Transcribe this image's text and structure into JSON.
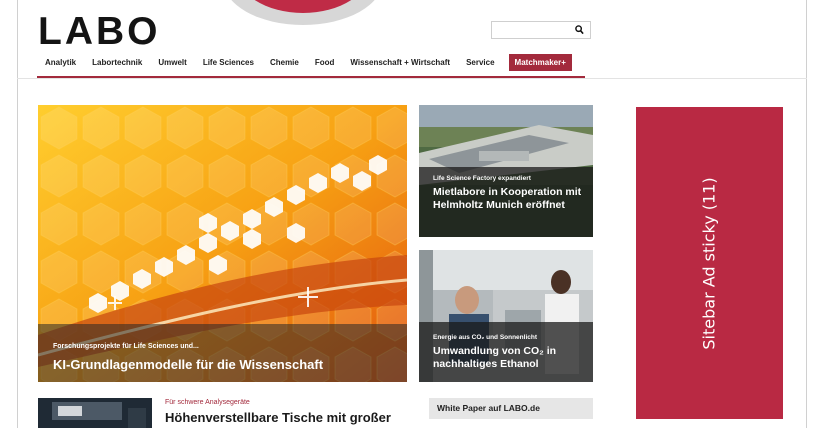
{
  "site": {
    "logo": "LABO"
  },
  "search": {
    "placeholder": "",
    "icon": "search-icon"
  },
  "nav": {
    "items": [
      "Analytik",
      "Labortechnik",
      "Umwelt",
      "Life Sciences",
      "Chemie",
      "Food",
      "Wissenschaft + Wirtschaft",
      "Service"
    ],
    "highlight": "Matchmaker+"
  },
  "hero": {
    "kicker": "Forschungsprojekte für Life Sciences und...",
    "title": "KI-Grundlagenmodelle für die Wissenschaft"
  },
  "card1": {
    "kicker": "Life Science Factory expandiert",
    "title": "Mietlabore in Kooperation mit Helmholtz Munich eröffnet"
  },
  "card2": {
    "kicker": "Energie aus CO₂ und Sonnenlicht",
    "title": "Umwandlung von CO₂ in nachhaltiges Ethanol"
  },
  "ad": {
    "label": "Sitebar Ad sticky (11)"
  },
  "article": {
    "kicker": "Für schwere Analysegeräte",
    "title": "Höhenverstellbare Tische mit großer"
  },
  "whitepaper": {
    "label": "White Paper auf LABO.de"
  },
  "colors": {
    "brand": "#a32a3c",
    "ad": "#b92943"
  }
}
